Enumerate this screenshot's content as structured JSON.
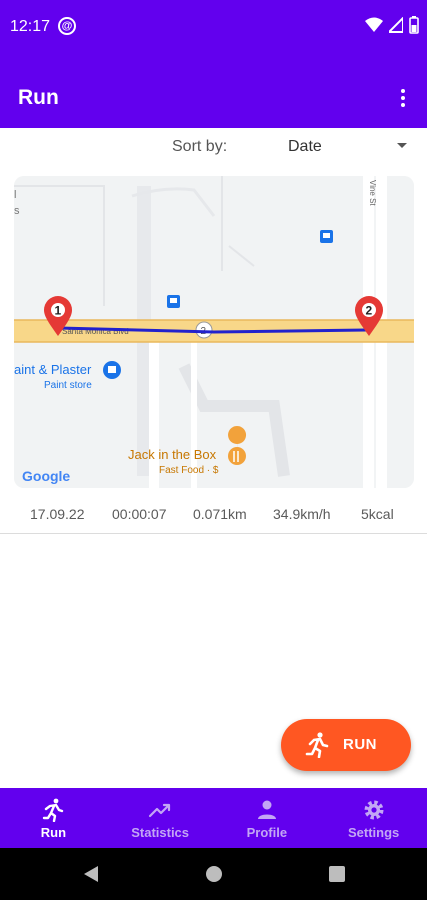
{
  "status_bar": {
    "time": "12:17",
    "at_symbol": "@"
  },
  "app_bar": {
    "title": "Run"
  },
  "sort": {
    "label": "Sort by:",
    "value": "Date"
  },
  "run_card": {
    "map": {
      "street_santa_monica": "Santa Monica Blvd",
      "street_vine": "Vine St",
      "route_shield": "2",
      "place_1_name": "aint & Plaster",
      "place_1_category": "Paint store",
      "place_2_name": "Jack in the Box",
      "place_2_category": "Fast Food · $",
      "marker_start": "1",
      "marker_end": "2",
      "left_edge_text": [
        "l",
        "s"
      ],
      "attribution": "Google"
    },
    "date": "17.09.22",
    "duration": "00:00:07",
    "distance": "0.071km",
    "speed": "34.9km/h",
    "calories": "5kcal"
  },
  "fab": {
    "label": "RUN"
  },
  "bottom_nav": [
    {
      "label": "Run",
      "icon": "directions-run-icon",
      "active": true
    },
    {
      "label": "Statistics",
      "icon": "trending-up-icon",
      "active": false
    },
    {
      "label": "Profile",
      "icon": "person-icon",
      "active": false
    },
    {
      "label": "Settings",
      "icon": "gear-icon",
      "active": false
    }
  ],
  "colors": {
    "primary": "#6200EE",
    "accent": "#FF5722",
    "route": "#2222CC",
    "marker": "#E53935"
  }
}
